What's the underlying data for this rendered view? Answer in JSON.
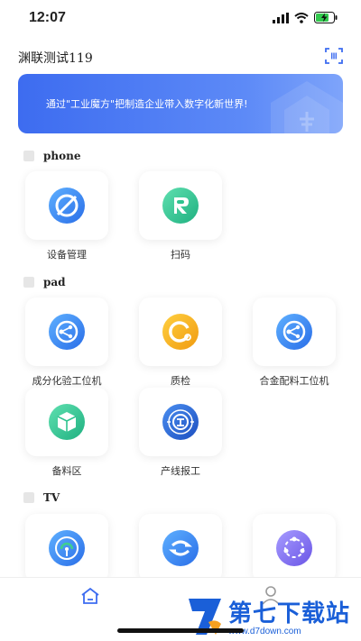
{
  "status_bar": {
    "time": "12:07"
  },
  "header": {
    "title": "渊联测试119"
  },
  "banner": {
    "text": "通过\"工业魔方\"把制造企业带入数字化新世界!"
  },
  "sections": [
    {
      "title": "phone",
      "apps": [
        {
          "label": "设备管理"
        },
        {
          "label": "扫码"
        }
      ]
    },
    {
      "title": "pad",
      "apps": [
        {
          "label": "成分化验工位机"
        },
        {
          "label": "质检"
        },
        {
          "label": "合金配料工位机"
        },
        {
          "label": "备料区"
        },
        {
          "label": "产线报工"
        }
      ]
    },
    {
      "title": "TV",
      "apps": [
        {
          "label": ""
        },
        {
          "label": ""
        },
        {
          "label": ""
        }
      ]
    }
  ],
  "watermark": {
    "name": "第七下载站",
    "url": "www.d7down.com"
  },
  "colors": {
    "accent": "#3d6cf0",
    "green": "#2fc38f",
    "orange": "#f5b01a",
    "purple": "#7b6cf0"
  }
}
